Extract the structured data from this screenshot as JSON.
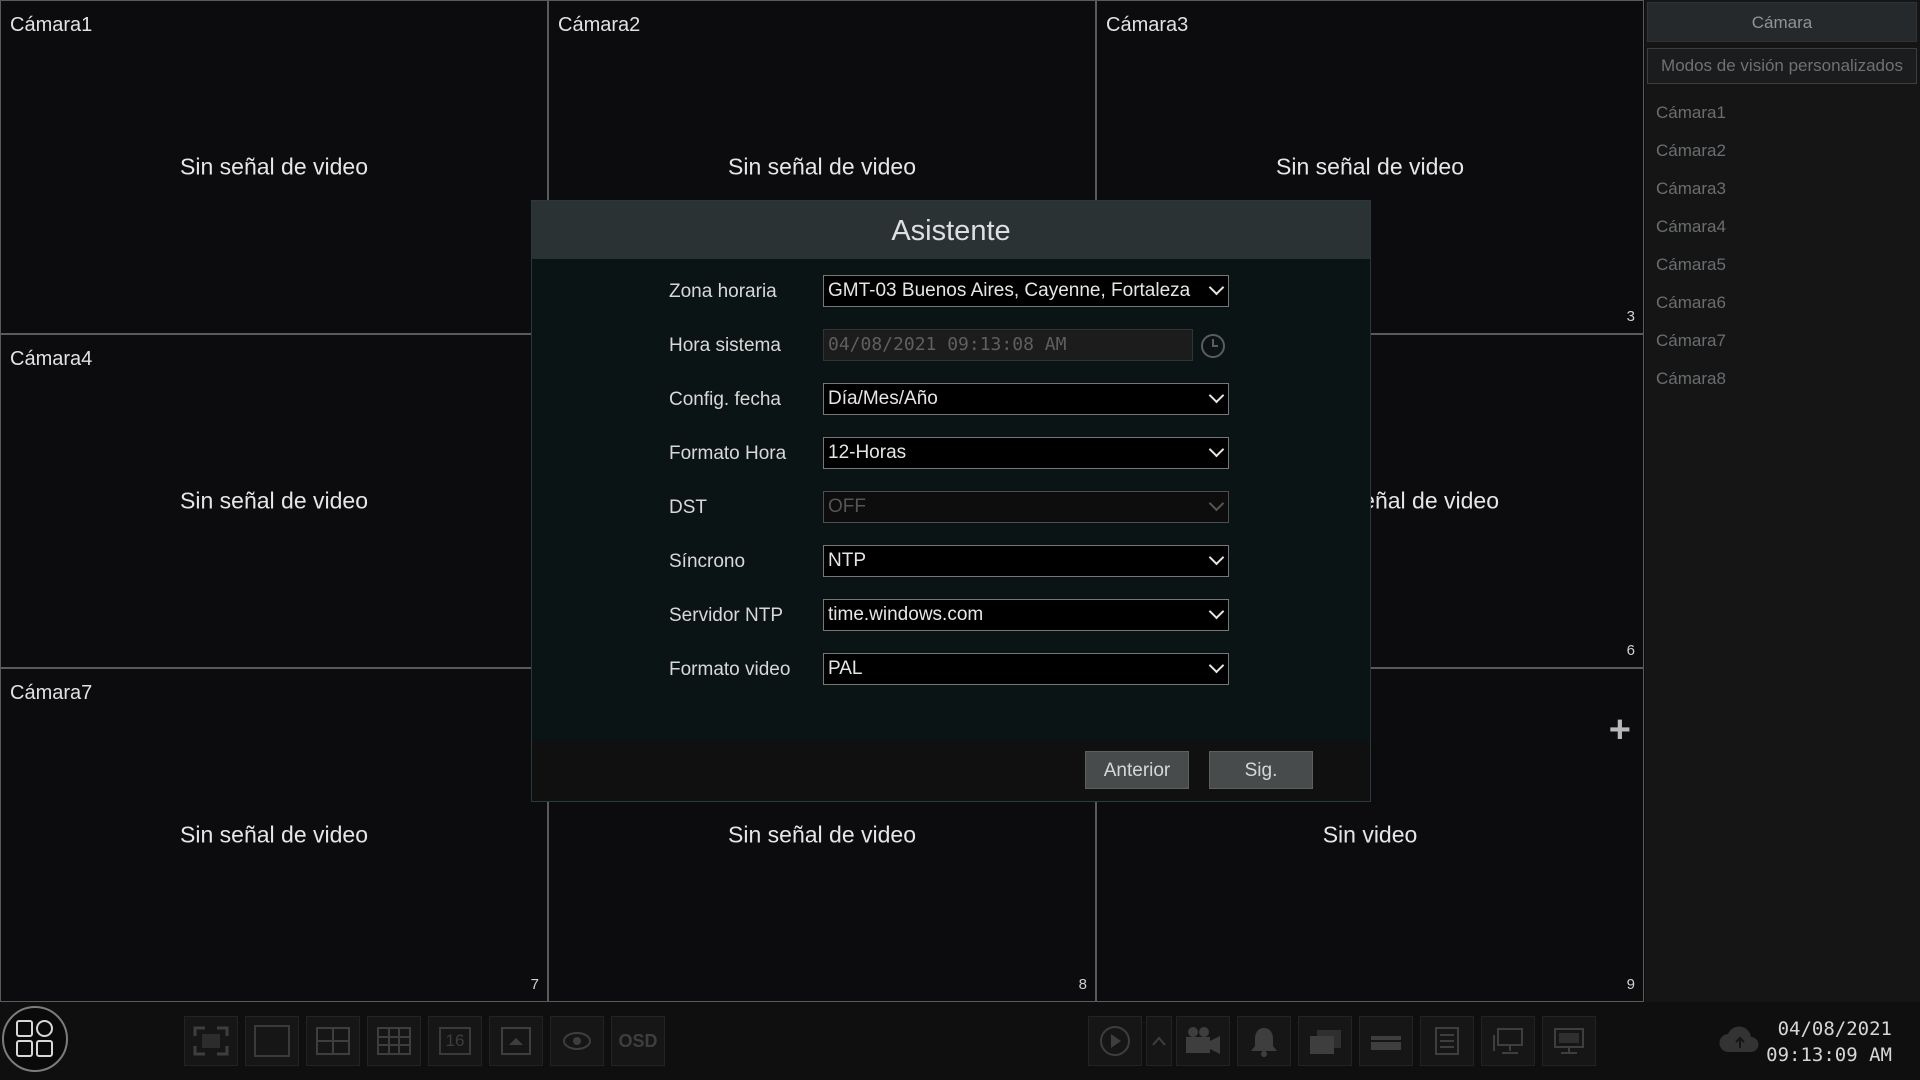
{
  "cameras": [
    {
      "name": "Cámara1",
      "message": "Sin señal de video",
      "number": ""
    },
    {
      "name": "Cámara2",
      "message": "Sin señal de video",
      "number": ""
    },
    {
      "name": "Cámara3",
      "message": "Sin señal de video",
      "number": "3"
    },
    {
      "name": "Cámara4",
      "message": "Sin señal de video",
      "number": ""
    },
    {
      "name": "",
      "message": "",
      "number": ""
    },
    {
      "name": "",
      "message": "Sin señal de video",
      "number": "6"
    },
    {
      "name": "Cámara7",
      "message": "Sin señal de video",
      "number": "7"
    },
    {
      "name": "",
      "message": "Sin señal de video",
      "number": "8"
    },
    {
      "name": "",
      "message": "Sin video",
      "number": "9"
    }
  ],
  "sidebar": {
    "header": "Cámara",
    "custom_views": "Modos de visión personalizados",
    "items": [
      "Cámara1",
      "Cámara2",
      "Cámara3",
      "Cámara4",
      "Cámara5",
      "Cámara6",
      "Cámara7",
      "Cámara8"
    ]
  },
  "dialog": {
    "title": "Asistente",
    "fields": {
      "timezone": {
        "label": "Zona horaria",
        "value": "GMT-03 Buenos Aires, Cayenne, Fortaleza"
      },
      "system_time": {
        "label": "Hora sistema",
        "value": "04/08/2021 09:13:08 AM"
      },
      "date_format": {
        "label": "Config. fecha",
        "value": "Día/Mes/Año"
      },
      "time_format": {
        "label": "Formato Hora",
        "value": "12-Horas"
      },
      "dst": {
        "label": "DST",
        "value": "OFF"
      },
      "sync": {
        "label": "Síncrono",
        "value": "NTP"
      },
      "ntp_server": {
        "label": "Servidor NTP",
        "value": "time.windows.com"
      },
      "video_format": {
        "label": "Formato video",
        "value": "PAL"
      }
    },
    "buttons": {
      "previous": "Anterior",
      "next": "Sig."
    }
  },
  "toolbar": {
    "grid_16_label": "16",
    "osd_label": "OSD"
  },
  "clock": {
    "date": "04/08/2021",
    "time": "09:13:09 AM"
  }
}
